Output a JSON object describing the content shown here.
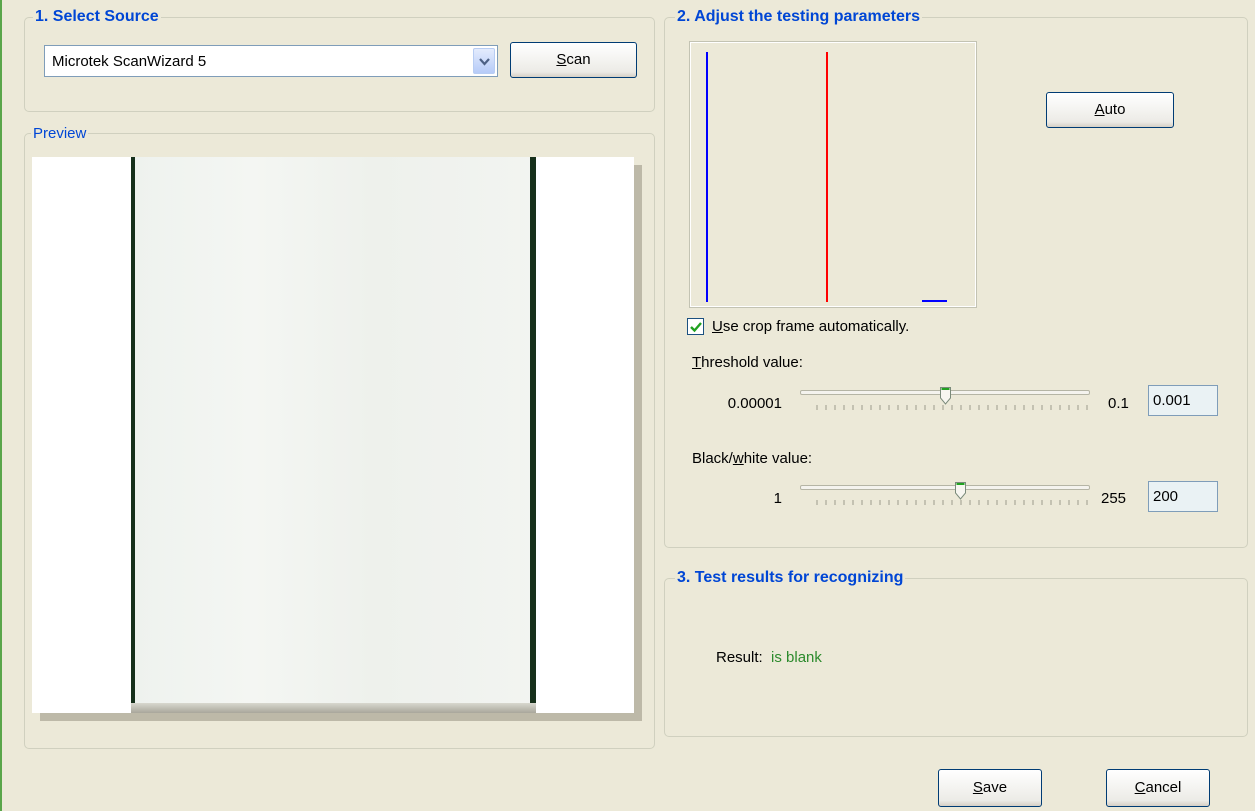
{
  "source_group": {
    "title": "1. Select Source",
    "selected_device": "Microtek ScanWizard 5",
    "scan_label_accel": "S",
    "scan_label_rest": "can"
  },
  "preview_group": {
    "title": "Preview"
  },
  "params_group": {
    "title": "2. Adjust the testing parameters",
    "auto_label_accel": "A",
    "auto_label_rest": "uto",
    "use_crop_checked": true,
    "use_crop_label_accel": "U",
    "use_crop_label_rest": "se crop frame automatically.",
    "threshold": {
      "label_accel": "T",
      "label_rest": "hreshold value:",
      "min": "0.00001",
      "max": "0.1",
      "value": "0.001",
      "slider_position_fraction": 0.5
    },
    "bw": {
      "label_pre": "Black/",
      "label_accel": "w",
      "label_rest": "hite value:",
      "min": "1",
      "max": "255",
      "value": "200",
      "slider_position_fraction": 0.55
    }
  },
  "histogram_data": {
    "type": "histogram",
    "markers": [
      {
        "name": "black level",
        "color": "#0000ff",
        "position_fraction": 0.02
      },
      {
        "name": "threshold",
        "color": "#ff0000",
        "position_fraction": 0.5
      }
    ],
    "series": [
      {
        "color": "#0000ff",
        "bump_start_fraction": 0.88,
        "bump_end_fraction": 0.98
      }
    ]
  },
  "results_group": {
    "title": "3. Test results for recognizing",
    "result_label": "Result:",
    "result_value": "is blank"
  },
  "footer": {
    "save_label_accel": "S",
    "save_label_rest": "ave",
    "cancel_label_accel": "C",
    "cancel_label_rest": "ancel"
  },
  "colors": {
    "window_bg": "#ece9d8",
    "group_title": "#0046d5",
    "result_text": "#2c8a2c"
  }
}
